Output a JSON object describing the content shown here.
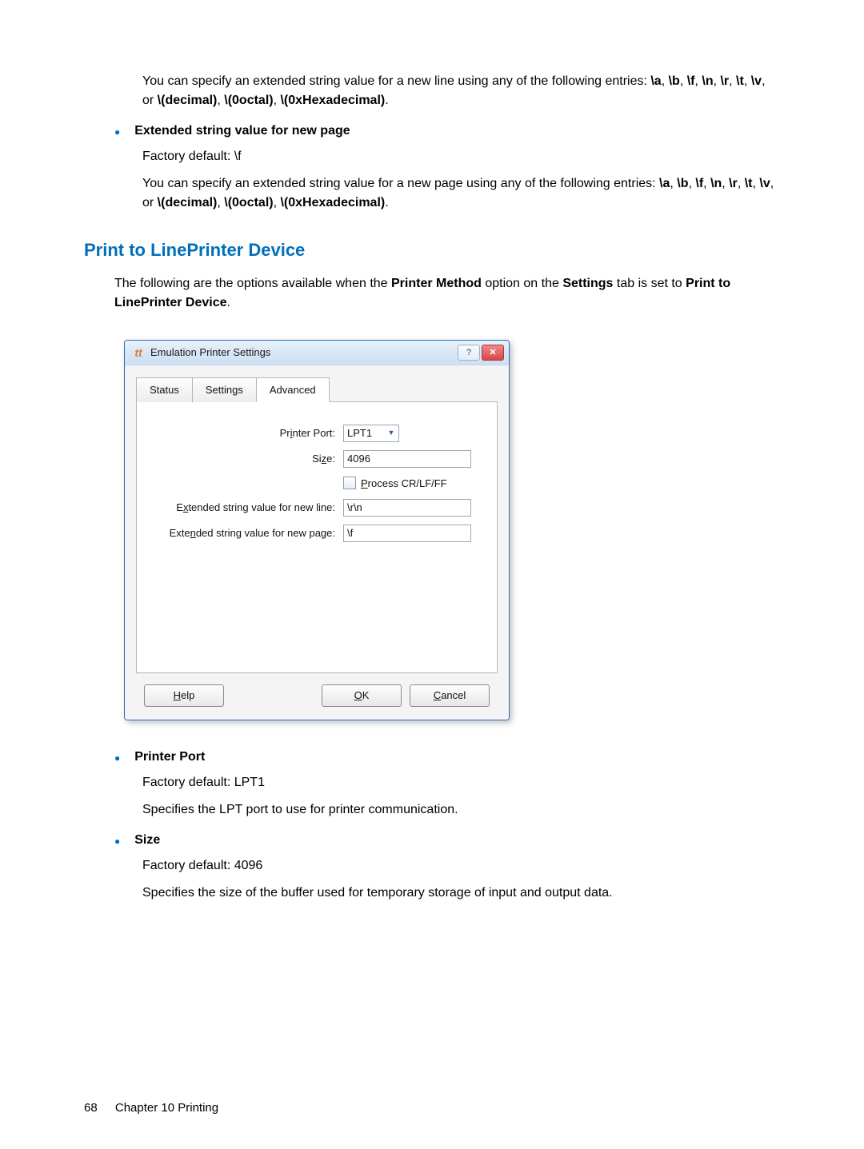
{
  "top": {
    "para1_a": "You can specify an extended string value for a new line using any of the following entries: ",
    "escape_list": "\\a, \\b, \\f, \\n, \\r, \\t, \\v",
    "or": ", or ",
    "bold_dec": "\\(decimal)",
    "sep": ", ",
    "bold_oct": "\\(0octal)",
    "bold_hex": "\\(0xHexadecimal)",
    "period": "."
  },
  "bullet_ext_page": {
    "title": "Extended string value for new page",
    "default": "Factory default: \\f",
    "para_a": "You can specify an extended string value for a new page using any of the following entries: "
  },
  "section_heading": "Print to LinePrinter Device",
  "intro": {
    "a": "The following are the options available when the ",
    "b": "Printer Method",
    "c": " option on the ",
    "d": "Settings",
    "e": " tab is set to ",
    "f": "Print to LinePrinter Device",
    "g": "."
  },
  "dialog": {
    "title": "Emulation Printer Settings",
    "tabs": {
      "status": "Status",
      "settings": "Settings",
      "advanced": "Advanced"
    },
    "labels": {
      "printer_port": "Printer Port:",
      "size": "Size:",
      "process": "Process CR/LF/FF",
      "newline": "Extended string value for new line:",
      "newpage": "Extended string value for new page:"
    },
    "values": {
      "printer_port": "LPT1",
      "size": "4096",
      "newline": "\\r\\n",
      "newpage": "\\f"
    },
    "buttons": {
      "help": "Help",
      "ok": "OK",
      "cancel": "Cancel"
    },
    "underline": {
      "help": "H",
      "ok": "O",
      "cancel": "C",
      "printer_port": "i",
      "size": "z",
      "process": "P",
      "newline": "x",
      "newpage": "n"
    }
  },
  "after": {
    "printer_port": {
      "title": "Printer Port",
      "default": "Factory default: LPT1",
      "desc": "Specifies the LPT port to use for printer communication."
    },
    "size": {
      "title": "Size",
      "default": "Factory default: 4096",
      "desc": "Specifies the size of the buffer used for temporary storage of input and output data."
    }
  },
  "footer": {
    "page": "68",
    "chapter": "Chapter 10   Printing"
  }
}
